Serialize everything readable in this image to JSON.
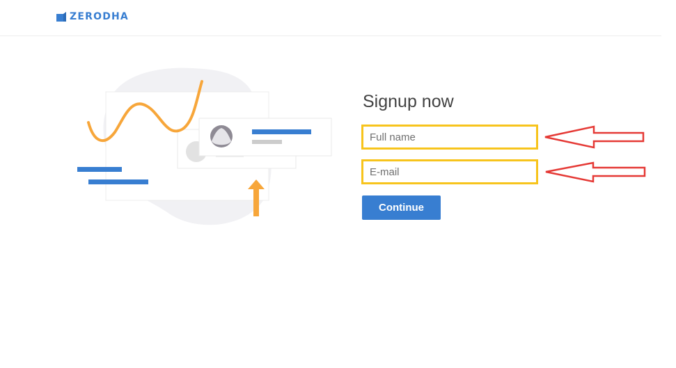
{
  "header": {
    "brand_name": "ZERODHA",
    "brand_color": "#387ed1",
    "logo_icon": "zerodha-logo-icon"
  },
  "signup": {
    "title": "Signup now",
    "full_name": {
      "placeholder": "Full name",
      "value": ""
    },
    "email": {
      "placeholder": "E-mail",
      "value": ""
    },
    "continue_label": "Continue"
  },
  "annotations": {
    "highlight_color": "#f7c41c",
    "arrow_color": "#e53935",
    "arrow_icon": "left-arrow-icon"
  },
  "illustration": {
    "icon": "signup-illustration",
    "accent_blue": "#387ed1",
    "accent_orange": "#f7a63a"
  }
}
